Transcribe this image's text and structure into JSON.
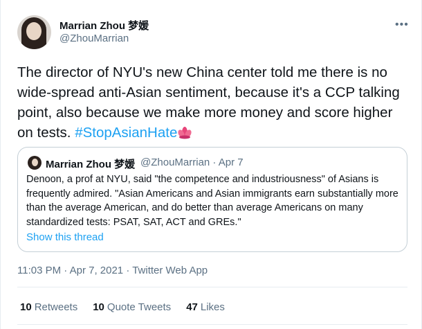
{
  "author": {
    "name": "Marrian Zhou 梦媛",
    "handle": "@ZhouMarrian"
  },
  "tweet": {
    "text": "The director of NYU's new China center told me there is no wide-spread anti-Asian sentiment, because it's a CCP talking point, also because we make more money and score higher on tests. ",
    "hashtag": "#StopAsianHate",
    "emoji": "lotus-icon"
  },
  "quote": {
    "name": "Marrian Zhou 梦媛",
    "handle_date": "@ZhouMarrian · Apr 7",
    "text": "Denoon, a prof at NYU, said \"the competence and industriousness\" of Asians is frequently admired. \"Asian Americans and Asian immigrants earn substantially more than the average American, and do better than average Americans on many standardized tests: PSAT, SAT, ACT and GREs.\"",
    "show_thread": "Show this thread"
  },
  "meta": {
    "timestamp": "11:03 PM · Apr 7, 2021 · Twitter Web App"
  },
  "stats": {
    "retweets_count": "10",
    "retweets_label": "Retweets",
    "quotes_count": "10",
    "quotes_label": "Quote Tweets",
    "likes_count": "47",
    "likes_label": "Likes"
  },
  "more_icon": "more-icon",
  "colors": {
    "link": "#1da1f2",
    "secondary": "#5b7083",
    "text": "#0f1419"
  }
}
